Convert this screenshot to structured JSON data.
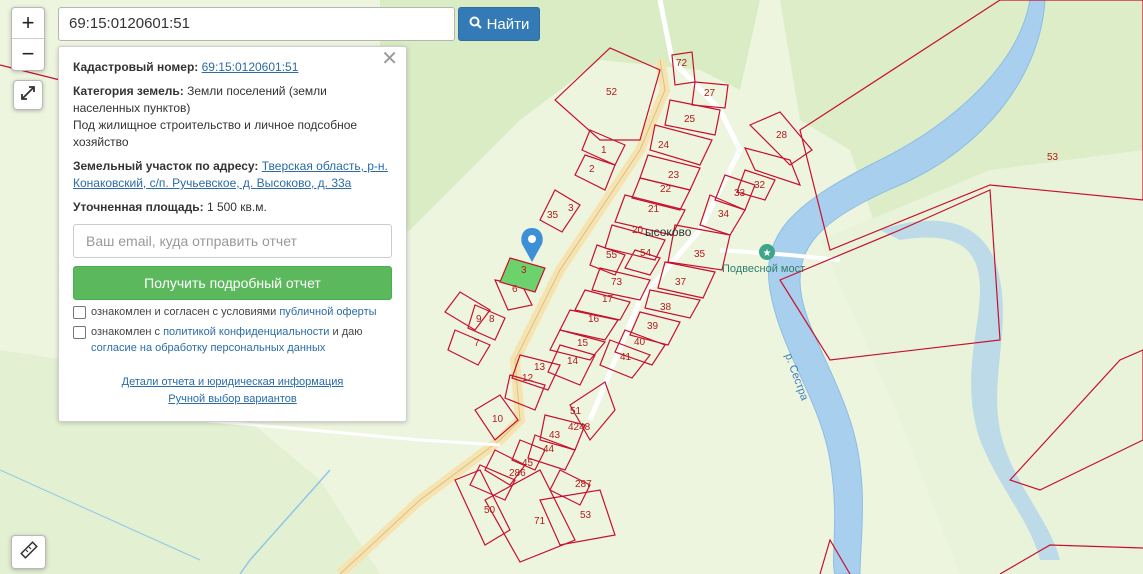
{
  "search": {
    "value": "69:15:0120601:51",
    "button_label": "Найти"
  },
  "zoom": {
    "in": "+",
    "out": "−"
  },
  "panel": {
    "cadastral_label": "Кадастровый номер:",
    "cadastral_number": "69:15:0120601:51",
    "category_label": "Категория земель:",
    "category_value": "Земли поселений (земли населенных пунктов)",
    "usage": "Под жилищное строительство и личное подсобное хозяйство",
    "address_label": "Земельный участок по адресу:",
    "address_value": "Тверская область, р-н. Конаковский, с/п. Ручьевское, д. Высоково, д. 33а",
    "area_label": "Уточненная площадь:",
    "area_value": "1 500 кв.м.",
    "email_placeholder": "Ваш email, куда отправить отчет",
    "report_button": "Получить подробный отчет",
    "consent1_text": "ознакомлен и согласен с условиями",
    "consent1_link": "публичной оферты",
    "consent2_text_a": "ознакомлен с",
    "consent2_link_a": "политикой конфиденциальности",
    "consent2_text_b": "и даю",
    "consent2_link_b": "согласие на обработку персональных данных",
    "details_link": "Детали отчета и юридическая информация",
    "manual_link": "Ручной выбор вариантов"
  },
  "map": {
    "village_label": "ысоково",
    "poi_label": "Подвесной мост",
    "river_label": "р. Сестра",
    "parcel_labels": [
      "52",
      "72",
      "27",
      "25",
      "24",
      "28",
      "1",
      "2",
      "23",
      "22",
      "33",
      "32",
      "21",
      "34",
      "3",
      "35",
      "20",
      "54",
      "55",
      "35",
      "37",
      "73",
      "17",
      "38",
      "16",
      "39",
      "40",
      "41",
      "15",
      "14",
      "13",
      "12",
      "9",
      "8",
      "7",
      "10",
      "6",
      "51",
      "4248",
      "43",
      "44",
      "45",
      "286",
      "287",
      "50",
      "71",
      "53",
      "53",
      "3"
    ],
    "colors": {
      "parcel": "#c8102e",
      "selected": "#6cd36c",
      "river": "#a9cfee",
      "road": "#f6e3b0",
      "forest": "#d9ecc3"
    }
  }
}
